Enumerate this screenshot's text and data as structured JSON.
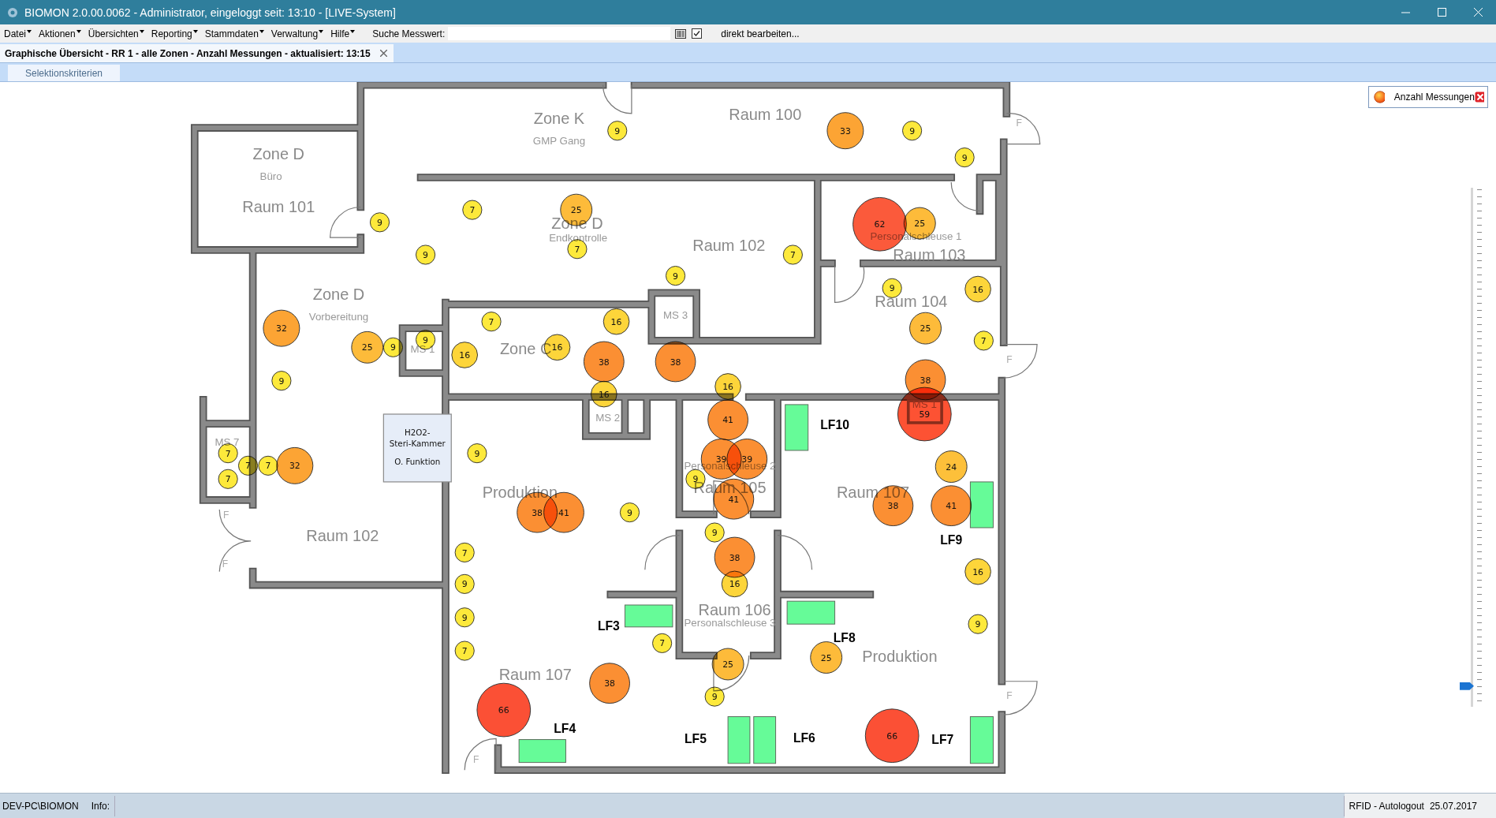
{
  "window": {
    "title": "BIOMON 2.0.00.0062 - Administrator, eingeloggt seit: 13:10 - [LIVE-System]"
  },
  "menu": [
    {
      "label": "Datei"
    },
    {
      "label": "Aktionen"
    },
    {
      "label": "Übersichten"
    },
    {
      "label": "Reporting"
    },
    {
      "label": "Stammdaten"
    },
    {
      "label": "Verwaltung"
    },
    {
      "label": "Hilfe"
    }
  ],
  "search": {
    "label": "Suche Messwert:"
  },
  "direct_edit": {
    "checked": true,
    "label": "direkt bearbeiten..."
  },
  "tabs": [
    {
      "label": "Graphische Übersicht - RR 1 - alle Zonen - Anzahl Messungen - aktualisiert: 13:15",
      "selected": true
    }
  ],
  "subtabs": [
    {
      "label": "Selektionskriterien"
    }
  ],
  "plan": {
    "labels": [
      {
        "text": "Zone K",
        "kind": "title"
      },
      {
        "text": "GMP Gang",
        "kind": "sub"
      },
      {
        "text": "Raum 100",
        "kind": "title"
      },
      {
        "text": "Zone D",
        "kind": "title"
      },
      {
        "text": "Büro",
        "kind": "sub"
      },
      {
        "text": "Raum 101",
        "kind": "title"
      },
      {
        "text": "Zone D",
        "kind": "title"
      },
      {
        "text": "Endkontrolle",
        "kind": "sub"
      },
      {
        "text": "Raum 102",
        "kind": "title"
      },
      {
        "text": "Personalschleuse 1",
        "kind": "sub"
      },
      {
        "text": "Raum 103",
        "kind": "title"
      },
      {
        "text": "Zone D",
        "kind": "title"
      },
      {
        "text": "Vorbereitung",
        "kind": "sub"
      },
      {
        "text": "Raum 104",
        "kind": "title"
      },
      {
        "text": "MS 3",
        "kind": "sub"
      },
      {
        "text": "MS 1",
        "kind": "sub"
      },
      {
        "text": "Zone C",
        "kind": "title"
      },
      {
        "text": "MS 2",
        "kind": "sub"
      },
      {
        "text": "MS 1",
        "kind": "sub"
      },
      {
        "text": "MS 7",
        "kind": "sub"
      },
      {
        "text": "Personalschleuse 2",
        "kind": "sub"
      },
      {
        "text": "Produktion",
        "kind": "title"
      },
      {
        "text": "Raum 105",
        "kind": "title"
      },
      {
        "text": "Raum 107",
        "kind": "title"
      },
      {
        "text": "Raum 102",
        "kind": "title"
      },
      {
        "text": "Raum 106",
        "kind": "title"
      },
      {
        "text": "Personalschleuse 3",
        "kind": "sub"
      },
      {
        "text": "Produktion",
        "kind": "title"
      },
      {
        "text": "Raum 107",
        "kind": "title"
      },
      {
        "text": "F",
        "kind": "door"
      },
      {
        "text": "F",
        "kind": "door"
      },
      {
        "text": "F",
        "kind": "door"
      },
      {
        "text": "F",
        "kind": "door"
      },
      {
        "text": "F",
        "kind": "door"
      },
      {
        "text": "F",
        "kind": "door"
      }
    ],
    "equipment": {
      "lines": [
        "H2O2-",
        "Steri-Kammer"
      ],
      "status": "O. Funktion"
    },
    "stations": [
      {
        "label": "LF10"
      },
      {
        "label": "LF9"
      },
      {
        "label": "LF3"
      },
      {
        "label": "LF8"
      },
      {
        "label": "LF4"
      },
      {
        "label": "LF5"
      },
      {
        "label": "LF6"
      },
      {
        "label": "LF7"
      }
    ],
    "markers": [
      {
        "value": "9",
        "kind": "xs",
        "color": "#fde93b"
      },
      {
        "value": "33",
        "kind": "l",
        "color": "#fca434"
      },
      {
        "value": "9",
        "kind": "xs",
        "color": "#fde93b"
      },
      {
        "value": "9",
        "kind": "xs",
        "color": "#fde93b"
      },
      {
        "value": "9",
        "kind": "xs",
        "color": "#fde93b"
      },
      {
        "value": "7",
        "kind": "xs",
        "color": "#fde93b"
      },
      {
        "value": "25",
        "kind": "m",
        "color": "#fdbb3a"
      },
      {
        "value": "62",
        "kind": "xxl",
        "color": "#fb5a3b"
      },
      {
        "value": "25",
        "kind": "m",
        "color": "#fdbb3a"
      },
      {
        "value": "9",
        "kind": "xs",
        "color": "#fde93b"
      },
      {
        "value": "7",
        "kind": "xs",
        "color": "#fde93b"
      },
      {
        "value": "7",
        "kind": "xs",
        "color": "#fde93b"
      },
      {
        "value": "9",
        "kind": "xs",
        "color": "#fde93b"
      },
      {
        "value": "9",
        "kind": "xs",
        "color": "#fde93b"
      },
      {
        "value": "16",
        "kind": "s",
        "color": "#fdd53a"
      },
      {
        "value": "32",
        "kind": "l",
        "color": "#fca434"
      },
      {
        "value": "7",
        "kind": "xs",
        "color": "#fde93b"
      },
      {
        "value": "16",
        "kind": "s",
        "color": "#fdd53a"
      },
      {
        "value": "25",
        "kind": "m",
        "color": "#fdbb3a"
      },
      {
        "value": "25",
        "kind": "m",
        "color": "#fdbb3a"
      },
      {
        "value": "9",
        "kind": "xs",
        "color": "#fde93b"
      },
      {
        "value": "9",
        "kind": "xs",
        "color": "#fde93b"
      },
      {
        "value": "16",
        "kind": "s",
        "color": "#fdd53a"
      },
      {
        "value": "16",
        "kind": "s",
        "color": "#fdd53a"
      },
      {
        "value": "38",
        "kind": "xl",
        "color": "#fb8f33"
      },
      {
        "value": "38",
        "kind": "xl",
        "color": "#fb8f33"
      },
      {
        "value": "7",
        "kind": "xs",
        "color": "#fde93b"
      },
      {
        "value": "9",
        "kind": "xs",
        "color": "#fde93b"
      },
      {
        "value": "16",
        "kind": "s",
        "color": "#fdd53a"
      },
      {
        "value": "16",
        "kind": "s",
        "color": "#fdd53a"
      },
      {
        "value": "38",
        "kind": "xl",
        "color": "#fb8f33"
      },
      {
        "value": "41",
        "kind": "xl",
        "color": "#fb8f33"
      },
      {
        "value": "59",
        "kind": "xxl",
        "color": "#fd5233"
      },
      {
        "value": "9",
        "kind": "xs",
        "color": "#fde93b"
      },
      {
        "value": "7",
        "kind": "xs",
        "color": "#fde93b"
      },
      {
        "value": "7",
        "kind": "xs",
        "color": "#fde93b"
      },
      {
        "value": "7",
        "kind": "xs",
        "color": "#fde93b"
      },
      {
        "value": "32",
        "kind": "l",
        "color": "#fca434"
      },
      {
        "value": "7",
        "kind": "xs",
        "color": "#fde93b"
      },
      {
        "value": "39",
        "kind": "xl",
        "color": "#fb8f33"
      },
      {
        "value": "39",
        "kind": "xl",
        "color": "#fb8f33"
      },
      {
        "value": "24",
        "kind": "m",
        "color": "#fdc03a"
      },
      {
        "value": "9",
        "kind": "xs",
        "color": "#fde93b"
      },
      {
        "value": "41",
        "kind": "xl",
        "color": "#fb8f33"
      },
      {
        "value": "38",
        "kind": "xl",
        "color": "#fb8f33"
      },
      {
        "value": "41",
        "kind": "xl",
        "color": "#fb8f33"
      },
      {
        "value": "9",
        "kind": "xs",
        "color": "#fde93b"
      },
      {
        "value": "38",
        "kind": "xl",
        "color": "#fb8f33"
      },
      {
        "value": "41",
        "kind": "xl",
        "color": "#fb8f33"
      },
      {
        "value": "9",
        "kind": "xs",
        "color": "#fde93b"
      },
      {
        "value": "38",
        "kind": "xl",
        "color": "#fb8f33"
      },
      {
        "value": "7",
        "kind": "xs",
        "color": "#fde93b"
      },
      {
        "value": "16",
        "kind": "s",
        "color": "#fdd53a"
      },
      {
        "value": "16",
        "kind": "s",
        "color": "#fdd53a"
      },
      {
        "value": "9",
        "kind": "xs",
        "color": "#fde93b"
      },
      {
        "value": "9",
        "kind": "xs",
        "color": "#fde93b"
      },
      {
        "value": "9",
        "kind": "xs",
        "color": "#fde93b"
      },
      {
        "value": "7",
        "kind": "xs",
        "color": "#fde93b"
      },
      {
        "value": "25",
        "kind": "m",
        "color": "#fdbb3a"
      },
      {
        "value": "7",
        "kind": "xs",
        "color": "#fde93b"
      },
      {
        "value": "25",
        "kind": "m",
        "color": "#fdbb3a"
      },
      {
        "value": "38",
        "kind": "xl",
        "color": "#fb8f33"
      },
      {
        "value": "9",
        "kind": "xs",
        "color": "#fde93b"
      },
      {
        "value": "66",
        "kind": "xxl",
        "color": "#fb5035"
      },
      {
        "value": "66",
        "kind": "xxl",
        "color": "#fb5035"
      }
    ]
  },
  "legend": {
    "label": "Anzahl Messungen"
  },
  "zoom_slider": {
    "level": 0.04
  },
  "status_bar": {
    "user": "DEV-PC\\BIOMON",
    "info_label": "Info:",
    "rfid": "RFID - Autologout",
    "date": "25.07.2017"
  }
}
